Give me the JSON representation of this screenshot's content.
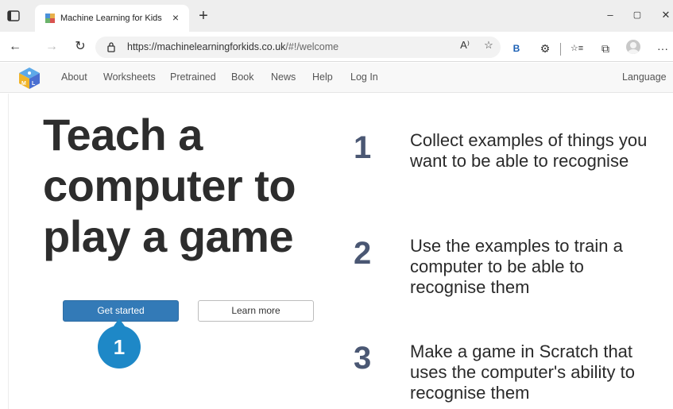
{
  "browser": {
    "tab_title": "Machine Learning for Kids",
    "tab_close": "×",
    "new_tab": "+",
    "window": {
      "minimize": "–",
      "maximize": "▢",
      "close": "✕"
    },
    "nav": {
      "back": "←",
      "forward": "→",
      "refresh": "↻"
    },
    "url": "https://machinelearningforkids.co.uk/#!/welcome",
    "url_host": "https://machinelearningforkids.co.uk",
    "url_path": "/#!/welcome",
    "toolbar": {
      "read_aloud": "A⁾",
      "favorite": "☆",
      "bing": "B",
      "extensions": "⚙",
      "favorites": "☆≡",
      "collections": "⧉",
      "more": "···"
    },
    "colors": {
      "tabbar": "#eeeeee",
      "omnibox": "#f2f2f2"
    }
  },
  "site": {
    "nav_items": [
      "About",
      "Worksheets",
      "Pretrained",
      "Book",
      "News",
      "Help",
      "Log In"
    ],
    "language": "Language",
    "headline": [
      "Teach a",
      "computer to",
      "play a game"
    ],
    "buttons": {
      "primary": "Get started",
      "secondary": "Learn more"
    },
    "callout": "1",
    "steps": [
      {
        "number": "1",
        "text": "Collect examples of things you want to be able to recognise"
      },
      {
        "number": "2",
        "text": "Use the examples to train a computer to be able to recognise them"
      },
      {
        "number": "3",
        "text": "Make a game in Scratch that uses the computer's ability to recognise them"
      }
    ],
    "colors": {
      "primary_button": "#337ab7",
      "callout": "#1e88c7",
      "step_number": "#4a5773"
    }
  }
}
